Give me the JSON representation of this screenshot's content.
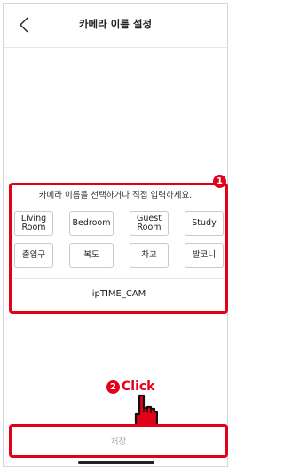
{
  "header": {
    "back_icon": "chevron-left-icon",
    "title": "카메라 이름 설정"
  },
  "instruction": "카메라 이름을 선택하거나 직접 입력하세요.",
  "markers": {
    "step1": "1",
    "step2": "2"
  },
  "presets": {
    "row1": [
      "Living\nRoom",
      "Bedroom",
      "Guest\nRoom",
      "Study"
    ],
    "row2": [
      "출입구",
      "복도",
      "차고",
      "발코니"
    ]
  },
  "name_field": {
    "value": "ipTIME_CAM"
  },
  "annotation": {
    "click_label": "Click",
    "hand_icon": "pointing-hand-icon"
  },
  "save_button": {
    "label": "저장"
  },
  "colors": {
    "highlight": "#e3001b",
    "disabled_text": "#a4a4a4"
  }
}
